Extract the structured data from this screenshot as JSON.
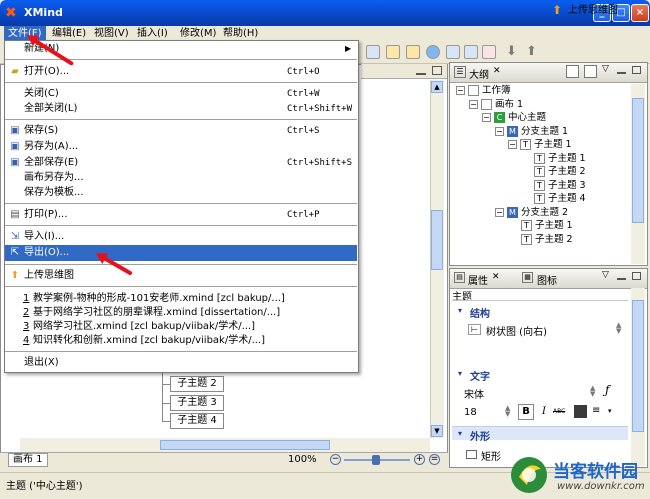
{
  "window": {
    "title": "XMind",
    "min": "_",
    "max": "□",
    "close": "×"
  },
  "menubar": [
    {
      "id": "file",
      "label": "文件(F)"
    },
    {
      "id": "edit",
      "label": "编辑(E)"
    },
    {
      "id": "view",
      "label": "视图(V)"
    },
    {
      "id": "insert",
      "label": "插入(I)"
    },
    {
      "id": "modify",
      "label": "修改(M)"
    },
    {
      "id": "help",
      "label": "帮助(H)"
    }
  ],
  "toolbar": {
    "upload_label": "上传思维图"
  },
  "file_menu": {
    "new": {
      "label": "新建(N)"
    },
    "open": {
      "label": "打开(O)...",
      "shortcut": "Ctrl+O"
    },
    "close": {
      "label": "关闭(C)",
      "shortcut": "Ctrl+W"
    },
    "close_all": {
      "label": "全部关闭(L)",
      "shortcut": "Ctrl+Shift+W"
    },
    "save": {
      "label": "保存(S)",
      "shortcut": "Ctrl+S"
    },
    "save_as": {
      "label": "另存为(A)..."
    },
    "save_all": {
      "label": "全部保存(E)",
      "shortcut": "Ctrl+Shift+S"
    },
    "save_canvas_as": {
      "label": "画布另存为..."
    },
    "save_as_template": {
      "label": "保存为模板..."
    },
    "print": {
      "label": "打印(P)...",
      "shortcut": "Ctrl+P"
    },
    "import": {
      "label": "导入(I)..."
    },
    "export": {
      "label": "导出(O)..."
    },
    "upload": {
      "label": "上传思维图"
    },
    "recent": [
      {
        "num": "1",
        "label": "教学案例-物种的形成-101安老师.xmind  [zcl bakup/...]"
      },
      {
        "num": "2",
        "label": "基于网络学习社区的朋辈课程.xmind  [dissertation/...]"
      },
      {
        "num": "3",
        "label": "网络学习社区.xmind  [zcl bakup/viibak/学术/...]"
      },
      {
        "num": "4",
        "label": "知识转化和创新.xmind  [zcl bakup/viibak/学术/...]"
      }
    ],
    "exit": {
      "label": "退出(X)"
    }
  },
  "canvas": {
    "topics": [
      "子主题 2",
      "子主题 3",
      "子主题 4"
    ]
  },
  "editor_tabs": {
    "tab": "画布 1",
    "zoom": "100%"
  },
  "outline": {
    "tab": "大纲",
    "items": [
      {
        "label": "工作簿",
        "icon": "workbook-icon",
        "level": 0,
        "exp": "−"
      },
      {
        "label": "画布 1",
        "icon": "sheet-icon",
        "level": 1,
        "exp": "−"
      },
      {
        "label": "中心主题",
        "icon": "central-topic-icon",
        "badge": "C",
        "level": 2,
        "exp": "−"
      },
      {
        "label": "分支主题 1",
        "icon": "main-topic-icon",
        "badge": "M",
        "level": 3,
        "exp": "−"
      },
      {
        "label": "子主题 1",
        "icon": "topic-icon",
        "badge": "T",
        "level": 4,
        "exp": "−"
      },
      {
        "label": "子主题 1",
        "icon": "topic-icon",
        "badge": "T",
        "level": 5
      },
      {
        "label": "子主题 2",
        "icon": "topic-icon",
        "badge": "T",
        "level": 5
      },
      {
        "label": "子主题 3",
        "icon": "topic-icon",
        "badge": "T",
        "level": 5
      },
      {
        "label": "子主题 4",
        "icon": "topic-icon",
        "badge": "T",
        "level": 5
      },
      {
        "label": "分支主题 2",
        "icon": "main-topic-icon",
        "badge": "M",
        "level": 3,
        "exp": "−"
      },
      {
        "label": "子主题 1",
        "icon": "topic-icon",
        "badge": "T",
        "level": 4
      },
      {
        "label": "子主题 2",
        "icon": "topic-icon",
        "badge": "T",
        "level": 4
      }
    ]
  },
  "properties": {
    "tab_props": "属性",
    "tab_icons": "图标",
    "subject": "主题",
    "structure_title": "结构",
    "structure_value": "树状图 (向右)",
    "text_title": "文字",
    "font": "宋体",
    "size": "18",
    "bold": "B",
    "italic": "I",
    "strike": "ABC",
    "shape_title": "外形",
    "shape_value": "矩形"
  },
  "status": {
    "text": "主题 ('中心主题')"
  },
  "watermark": {
    "brand": "当客软件园",
    "url": "www.downkr.com"
  },
  "colors": {
    "highlight": "#316ac5",
    "arrow": "#e8101a"
  }
}
